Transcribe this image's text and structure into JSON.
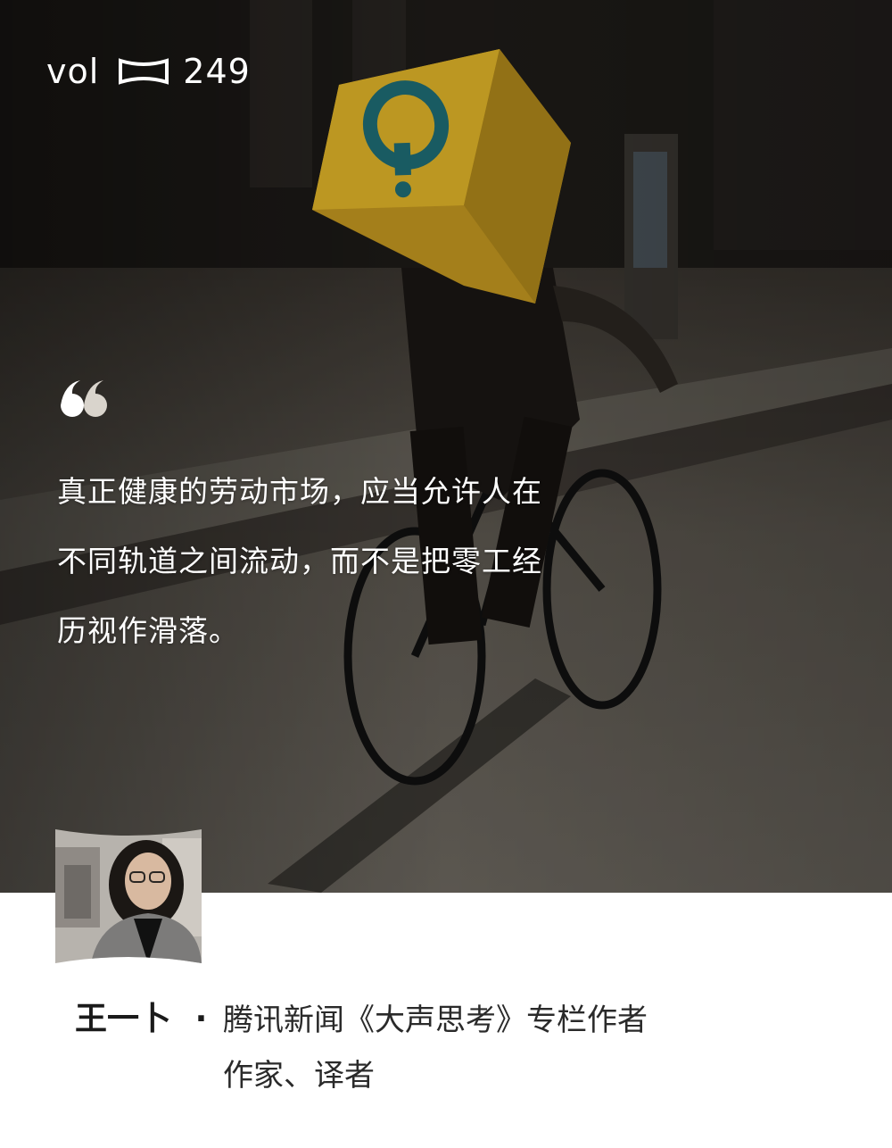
{
  "header": {
    "vol_prefix": "vol",
    "vol_number": "249"
  },
  "quote": {
    "lines": [
      "真正健康的劳动市场，应当允许人在",
      "不同轨道之间流动，而不是把零工经",
      "历视作滑落。"
    ]
  },
  "author": {
    "name": "王一卜",
    "separator": "·",
    "title_line1": "腾讯新闻《大声思考》专栏作者",
    "title_line2": "作家、译者"
  },
  "colors": {
    "text_on_photo": "#ffffff",
    "author_text": "#1a1a1a",
    "delivery_box": "#e6b92a",
    "logo_teal": "#1f6f78"
  },
  "icons": {
    "vol_logo": "bracket-logo-icon",
    "quote": "quote-mark-icon"
  }
}
